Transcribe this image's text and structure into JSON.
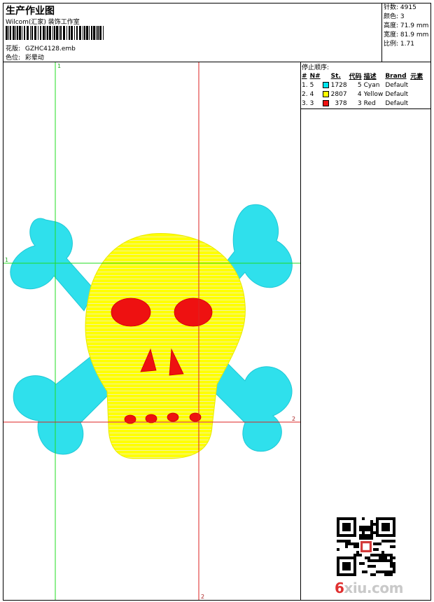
{
  "header": {
    "title": "生产作业图",
    "company": "Wilcom(汇家) 装饰工作室",
    "design_label": "花版:",
    "design_value": "GZHC4128.emb",
    "colorway_label": "色位:",
    "colorway_value": "彩晕动"
  },
  "stats": [
    {
      "label": "针数:",
      "value": "4915"
    },
    {
      "label": "颜色:",
      "value": "3"
    },
    {
      "label": "高度:",
      "value": "71.9 mm"
    },
    {
      "label": "宽度:",
      "value": "81.9 mm"
    },
    {
      "label": "比例:",
      "value": "1.71"
    }
  ],
  "canvas": {
    "guides": {
      "green_v": "1",
      "green_h": "1",
      "red_h": "2",
      "red_v": "2"
    }
  },
  "stop_sequence": {
    "title": "停止顺序:",
    "headers": [
      "#",
      "N#",
      "",
      "St.",
      "代码",
      "描述",
      "Brand",
      "元素"
    ],
    "rows": [
      {
        "num": "1.",
        "n": "5",
        "color": "#00e5ee",
        "stitches": "1728",
        "code": "5",
        "desc": "Cyan",
        "brand": "Default"
      },
      {
        "num": "2.",
        "n": "4",
        "color": "#ffff00",
        "stitches": "2807",
        "code": "4",
        "desc": "Yellow",
        "brand": "Default"
      },
      {
        "num": "3.",
        "n": "3",
        "color": "#ee1111",
        "stitches": "378",
        "code": "3",
        "desc": "Red",
        "brand": "Default"
      }
    ]
  },
  "watermark": {
    "pre": "6",
    "post": "xiu.com"
  },
  "colors": {
    "cyan": "#2fe0ec",
    "yellow": "#ffff00",
    "red": "#ee1111",
    "green_guide": "#22dd22",
    "red_guide": "#dd2222"
  }
}
